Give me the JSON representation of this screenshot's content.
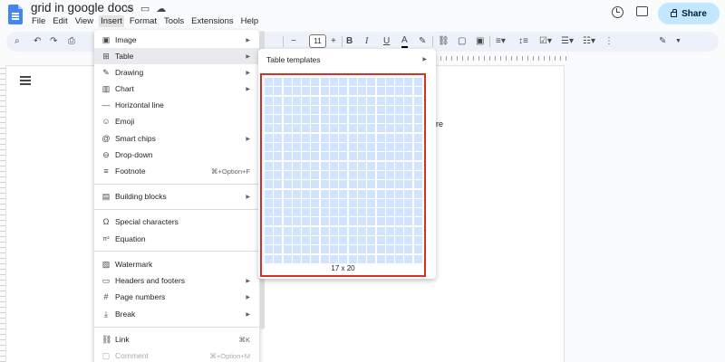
{
  "header": {
    "doc_title": "grid in google docs",
    "title_icons": [
      "star-icon",
      "move-folder-icon",
      "cloud-status-icon"
    ],
    "share_label": "Share"
  },
  "menubar": {
    "items": [
      "File",
      "Edit",
      "View",
      "Insert",
      "Format",
      "Tools",
      "Extensions",
      "Help"
    ],
    "active": "Insert"
  },
  "toolbar": {
    "font_size": "11",
    "minus": "−",
    "plus": "+",
    "bold": "B",
    "italic": "I",
    "underline": "U",
    "text_color": "A"
  },
  "insert_menu": {
    "items": [
      {
        "label": "Image",
        "icon": "image-icon",
        "glyph": "▣",
        "arrow": true
      },
      {
        "label": "Table",
        "icon": "table-icon",
        "glyph": "⊞",
        "arrow": true,
        "highlighted": true
      },
      {
        "label": "Drawing",
        "icon": "drawing-icon",
        "glyph": "✎",
        "arrow": true
      },
      {
        "label": "Chart",
        "icon": "chart-icon",
        "glyph": "▥",
        "arrow": true
      },
      {
        "label": "Horizontal line",
        "icon": "horizontal-line-icon",
        "glyph": "—"
      },
      {
        "label": "Emoji",
        "icon": "emoji-icon",
        "glyph": "☺"
      },
      {
        "label": "Smart chips",
        "icon": "smart-chips-icon",
        "glyph": "@",
        "arrow": true
      },
      {
        "label": "Drop-down",
        "icon": "dropdown-icon",
        "glyph": "⊖"
      },
      {
        "label": "Footnote",
        "icon": "footnote-icon",
        "glyph": "≡",
        "shortcut": "⌘+Option+F"
      },
      {
        "label": "Building blocks",
        "icon": "building-blocks-icon",
        "glyph": "▤",
        "arrow": true
      },
      {
        "label": "Special characters",
        "icon": "special-characters-icon",
        "glyph": "Ω"
      },
      {
        "label": "Equation",
        "icon": "equation-icon",
        "glyph": "π²"
      },
      {
        "label": "Watermark",
        "icon": "watermark-icon",
        "glyph": "▨"
      },
      {
        "label": "Headers and footers",
        "icon": "headers-footers-icon",
        "glyph": "▭",
        "arrow": true
      },
      {
        "label": "Page numbers",
        "icon": "page-numbers-icon",
        "glyph": "#",
        "arrow": true
      },
      {
        "label": "Break",
        "icon": "break-icon",
        "glyph": "⤓",
        "arrow": true
      },
      {
        "label": "Link",
        "icon": "link-icon",
        "glyph": "⛓",
        "shortcut": "⌘K"
      },
      {
        "label": "Comment",
        "icon": "comment-icon",
        "glyph": "▢",
        "shortcut": "⌘+Option+M",
        "disabled": true
      }
    ]
  },
  "table_submenu": {
    "templates_label": "Table templates",
    "grid_columns": 17,
    "grid_rows": 20,
    "size_label": "17 x 20"
  },
  "page": {
    "visible_text_fragment": "re"
  },
  "colors": {
    "accent": "#c2e7ff",
    "highlight_border": "#d93025",
    "grid_cell": "#d2e3fc"
  }
}
